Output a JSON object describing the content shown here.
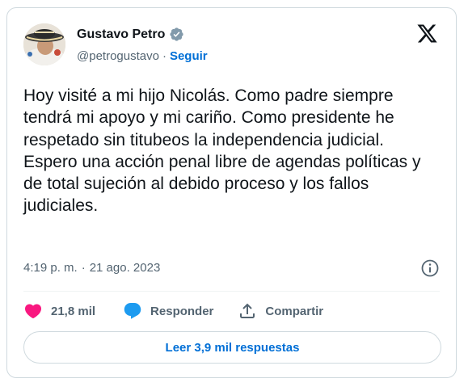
{
  "author": {
    "name": "Gustavo Petro",
    "handle": "@petrogustavo",
    "separator": "·",
    "follow_label": "Seguir"
  },
  "tweet": {
    "text": "Hoy visité a mi hijo Nicolás. Como padre siempre tendrá mi apoyo y mi cariño. Como presidente he respetado sin titubeos la independencia judicial. Espero una acción penal libre de agendas políticas y de total sujeción al debido proceso y los fallos judiciales.",
    "time": "4:19 p. m.",
    "separator": "·",
    "date": "21 ago. 2023"
  },
  "actions": {
    "like_count": "21,8 mil",
    "reply_label": "Responder",
    "share_label": "Compartir"
  },
  "footer": {
    "read_replies_label": "Leer 3,9 mil respuestas"
  },
  "colors": {
    "like": "#f91880",
    "reply": "#1d9bf0",
    "link": "#006fd6",
    "muted": "#536471",
    "verified": "#829aab"
  },
  "icons": {
    "verified": "verified-badge-icon",
    "brand": "x-logo-icon",
    "info": "info-icon",
    "like": "heart-icon",
    "reply": "reply-bubble-icon",
    "share": "share-icon"
  }
}
